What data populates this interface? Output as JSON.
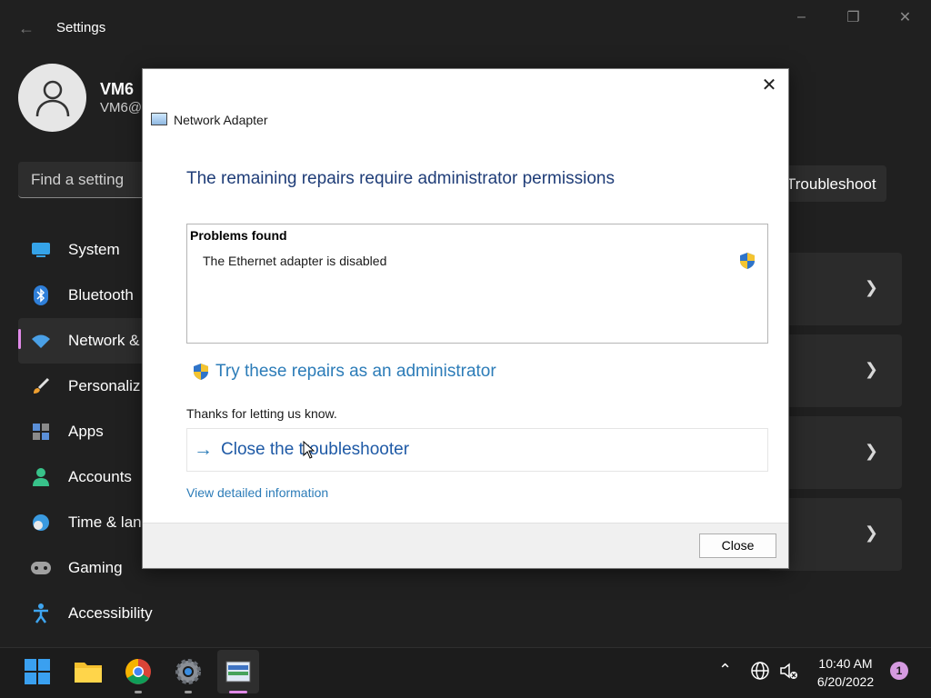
{
  "settings": {
    "app_title": "Settings",
    "user": {
      "name": "VM6",
      "email": "VM6@"
    },
    "search_placeholder": "Find a setting",
    "nav": [
      {
        "label": "System",
        "icon": "monitor-icon"
      },
      {
        "label": "Bluetooth",
        "icon": "bluetooth-icon"
      },
      {
        "label": "Network &",
        "icon": "wifi-icon",
        "active": true
      },
      {
        "label": "Personaliz",
        "icon": "brush-icon"
      },
      {
        "label": "Apps",
        "icon": "apps-icon"
      },
      {
        "label": "Accounts",
        "icon": "person-icon"
      },
      {
        "label": "Time & lan",
        "icon": "globe-clock-icon"
      },
      {
        "label": "Gaming",
        "icon": "gamepad-icon"
      },
      {
        "label": "Accessibility",
        "icon": "accessibility-icon"
      }
    ],
    "troubleshoot_label": "Troubleshoot"
  },
  "dialog": {
    "title": "Network Adapter",
    "heading": "The remaining repairs require administrator permissions",
    "problems_title": "Problems found",
    "problem_item": "The Ethernet adapter is disabled",
    "admin_link": "Try these repairs as an administrator",
    "thanks": "Thanks for letting us know.",
    "close_troubleshooter": "Close the troubleshooter",
    "view_details": "View detailed information",
    "close_button": "Close"
  },
  "taskbar": {
    "apps": [
      "start-icon",
      "file-explorer-icon",
      "chrome-icon",
      "settings-icon",
      "network-adapter-icon"
    ],
    "time": "10:40 AM",
    "date": "6/20/2022",
    "notification_count": "1"
  },
  "colors": {
    "accent": "#e08ae8",
    "link": "#2c7cb8",
    "heading": "#1f3d78"
  }
}
